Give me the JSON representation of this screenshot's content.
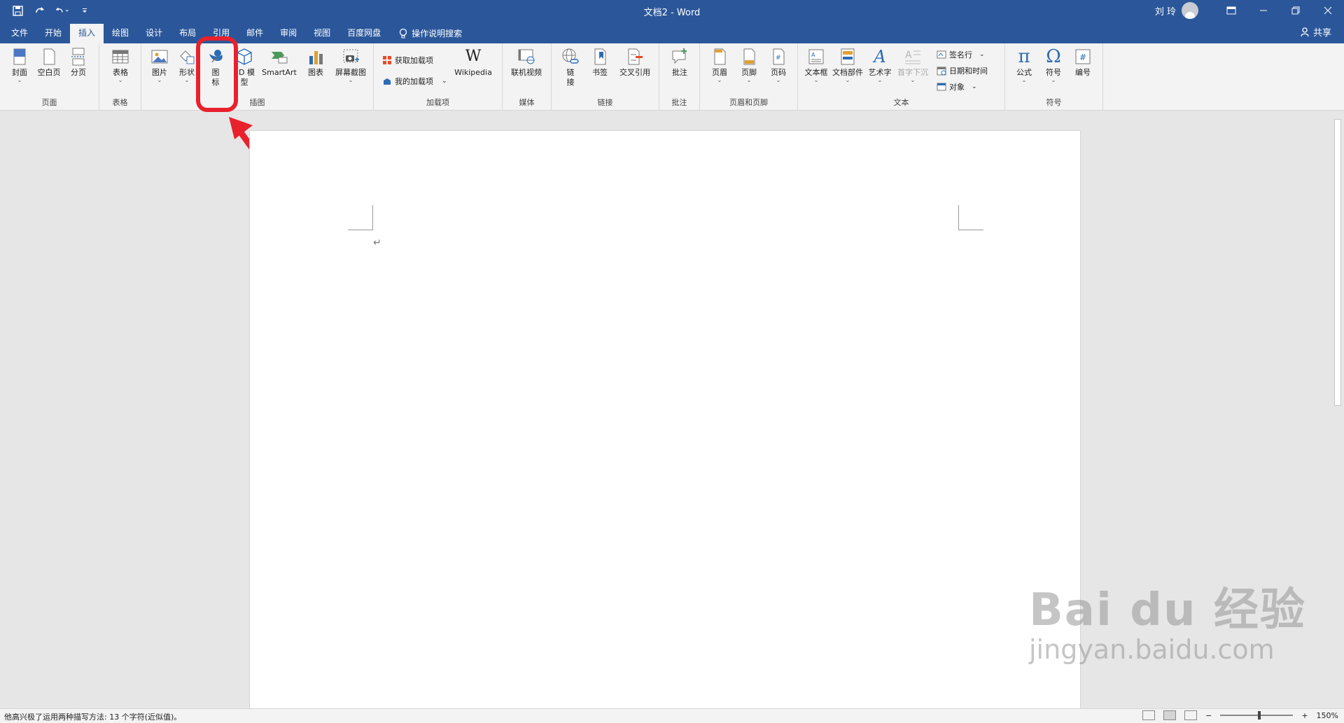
{
  "titlebar": {
    "doc_title": "文档2 - Word",
    "user_name": "刘 玲",
    "qat_icons": [
      "save-icon",
      "redo-icon",
      "undo-icon",
      "customize-icon"
    ]
  },
  "tabs": {
    "items": [
      {
        "label": "文件"
      },
      {
        "label": "开始"
      },
      {
        "label": "插入",
        "active": true
      },
      {
        "label": "绘图"
      },
      {
        "label": "设计"
      },
      {
        "label": "布局"
      },
      {
        "label": "引用"
      },
      {
        "label": "邮件"
      },
      {
        "label": "审阅"
      },
      {
        "label": "视图"
      },
      {
        "label": "百度网盘"
      }
    ],
    "tell_me": "操作说明搜索",
    "share": "共享"
  },
  "ribbon": {
    "pages": {
      "label": "页面",
      "cover": "封面",
      "blank": "空白页",
      "break": "分页"
    },
    "tables": {
      "label": "表格",
      "table": "表格"
    },
    "illustrations": {
      "label": "插图",
      "pictures": "图片",
      "shapes": "形状",
      "icons_l1": "图",
      "icons_l2": "标",
      "models_l1": "3D 模",
      "models_l2": "型",
      "smartart": "SmartArt",
      "chart": "图表",
      "screenshot": "屏幕截图"
    },
    "addins": {
      "label": "加载项",
      "get": "获取加载项",
      "mine": "我的加载项",
      "wiki": "Wikipedia"
    },
    "media": {
      "label": "媒体",
      "video": "联机视频"
    },
    "links": {
      "label": "链接",
      "link_l1": "链",
      "link_l2": "接",
      "bookmark": "书签",
      "cross": "交叉引用"
    },
    "comments": {
      "label": "批注",
      "comment": "批注"
    },
    "header_footer": {
      "label": "页眉和页脚",
      "header": "页眉",
      "footer": "页脚",
      "page_no": "页码"
    },
    "text": {
      "label": "文本",
      "textbox": "文本框",
      "quickparts": "文档部件",
      "wordart": "艺术字",
      "dropcap": "首字下沉",
      "sigline": "签名行",
      "datetime": "日期和时间",
      "object": "对象"
    },
    "symbols": {
      "label": "符号",
      "equation": "公式",
      "symbol": "符号",
      "number": "编号"
    }
  },
  "document": {
    "para_mark": "↵"
  },
  "status": {
    "text": "他高兴极了运用两种描写方法: 13 个字符(近似值)。",
    "zoom": "150%",
    "zoom_minus": "−",
    "zoom_plus": "+"
  },
  "watermark": {
    "main": "Bai du 经验",
    "sub": "jingyan.baidu.com"
  },
  "colors": {
    "brand": "#2b579a",
    "highlight": "#e8212c",
    "ribbon_bg": "#f3f3f3"
  }
}
